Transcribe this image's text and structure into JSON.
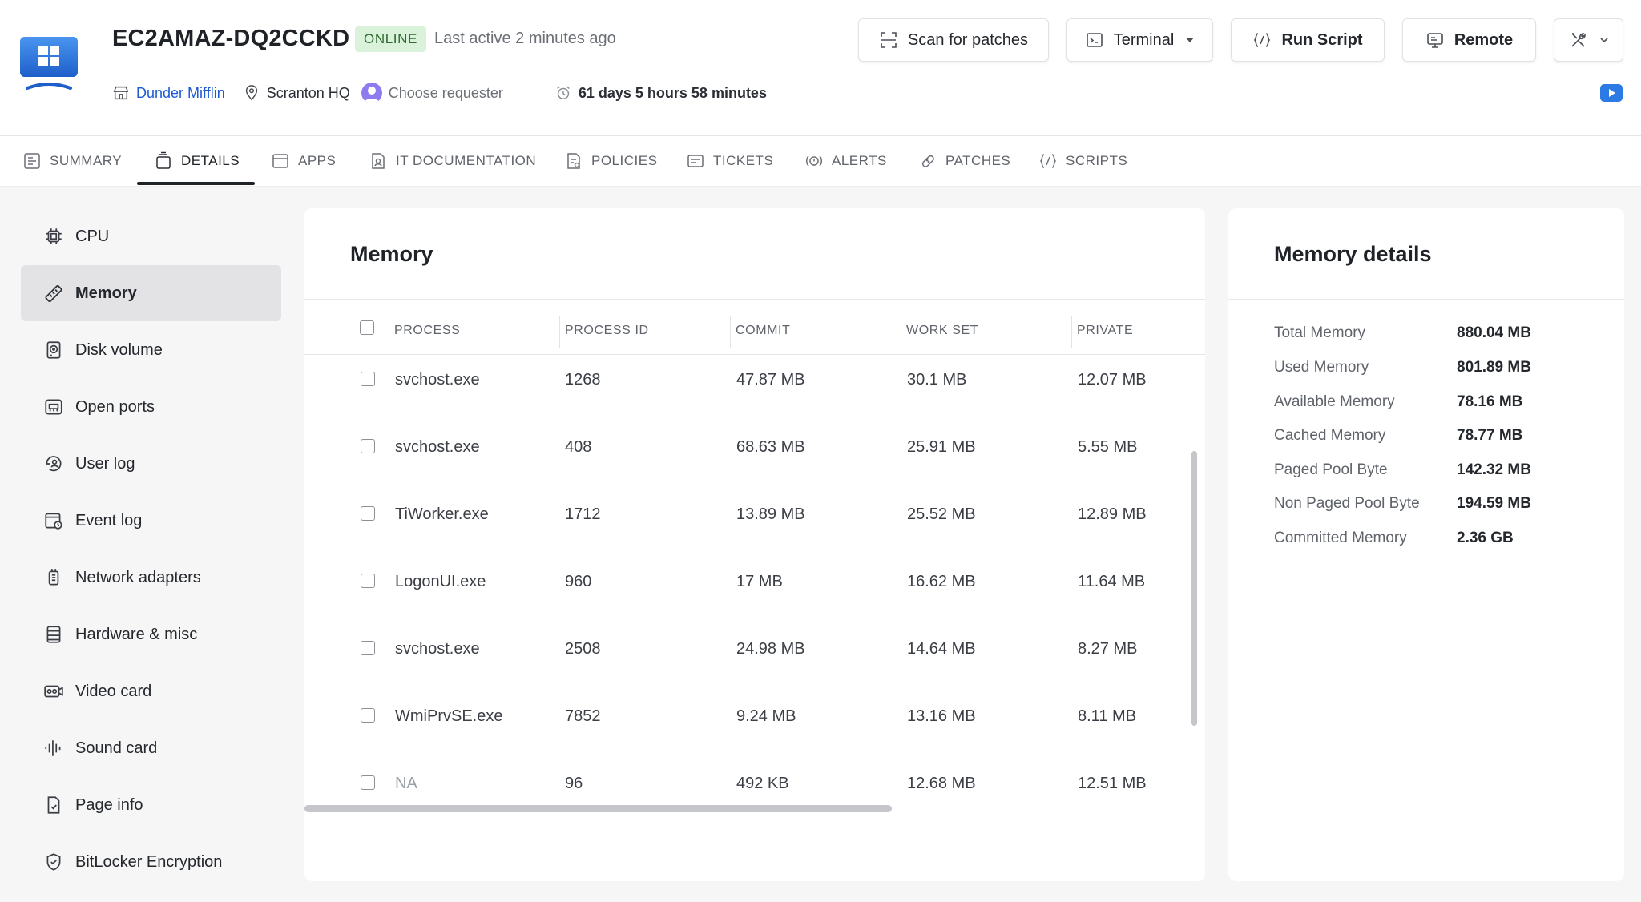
{
  "header": {
    "device_name": "EC2AMAZ-DQ2CCKD",
    "status": "ONLINE",
    "last_active": "Last active 2 minutes ago",
    "organization": "Dunder Mifflin",
    "location": "Scranton HQ",
    "requester_placeholder": "Choose requester",
    "uptime": "61 days 5 hours 58 minutes",
    "buttons": {
      "scan": "Scan for patches",
      "terminal": "Terminal",
      "run_script": "Run Script",
      "remote": "Remote"
    },
    "colors": {
      "status_bg": "#d9f2d9",
      "status_text": "#2f6b33",
      "link": "#1f5ad6",
      "windows_blue": "#2c7be5"
    }
  },
  "tabs": [
    {
      "label": "SUMMARY",
      "icon": "summary-icon"
    },
    {
      "label": "DETAILS",
      "icon": "details-icon",
      "active": true
    },
    {
      "label": "APPS",
      "icon": "apps-icon"
    },
    {
      "label": "IT DOCUMENTATION",
      "icon": "document-icon"
    },
    {
      "label": "POLICIES",
      "icon": "policies-icon"
    },
    {
      "label": "TICKETS",
      "icon": "ticket-icon"
    },
    {
      "label": "ALERTS",
      "icon": "alert-icon"
    },
    {
      "label": "PATCHES",
      "icon": "patch-icon"
    },
    {
      "label": "SCRIPTS",
      "icon": "script-icon"
    }
  ],
  "sidebar": {
    "items": [
      {
        "label": "CPU",
        "icon": "cpu-icon"
      },
      {
        "label": "Memory",
        "icon": "memory-icon",
        "active": true
      },
      {
        "label": "Disk volume",
        "icon": "disk-icon"
      },
      {
        "label": "Open ports",
        "icon": "ports-icon"
      },
      {
        "label": "User log",
        "icon": "user-log-icon"
      },
      {
        "label": "Event log",
        "icon": "event-log-icon"
      },
      {
        "label": "Network adapters",
        "icon": "network-adapter-icon"
      },
      {
        "label": "Hardware & misc",
        "icon": "hardware-icon"
      },
      {
        "label": "Video card",
        "icon": "video-card-icon"
      },
      {
        "label": "Sound card",
        "icon": "sound-card-icon"
      },
      {
        "label": "Page info",
        "icon": "page-info-icon"
      },
      {
        "label": "BitLocker Encryption",
        "icon": "shield-icon"
      }
    ]
  },
  "memory": {
    "title": "Memory",
    "columns": [
      "PROCESS",
      "PROCESS ID",
      "COMMIT",
      "WORK SET",
      "PRIVATE"
    ],
    "rows": [
      [
        "svchost.exe",
        "1268",
        "47.87 MB",
        "30.1 MB",
        "12.07 MB"
      ],
      [
        "svchost.exe",
        "408",
        "68.63 MB",
        "25.91 MB",
        "5.55 MB"
      ],
      [
        "TiWorker.exe",
        "1712",
        "13.89 MB",
        "25.52 MB",
        "12.89 MB"
      ],
      [
        "LogonUI.exe",
        "960",
        "17 MB",
        "16.62 MB",
        "11.64 MB"
      ],
      [
        "svchost.exe",
        "2508",
        "24.98 MB",
        "14.64 MB",
        "8.27 MB"
      ],
      [
        "WmiPrvSE.exe",
        "7852",
        "9.24 MB",
        "13.16 MB",
        "8.11 MB"
      ],
      [
        "NA",
        "96",
        "492 KB",
        "12.68 MB",
        "12.51 MB"
      ]
    ]
  },
  "memory_details": {
    "title": "Memory details",
    "items": [
      {
        "label": "Total Memory",
        "value": "880.04 MB"
      },
      {
        "label": "Used Memory",
        "value": "801.89 MB"
      },
      {
        "label": "Available Memory",
        "value": "78.16 MB"
      },
      {
        "label": "Cached Memory",
        "value": "78.77 MB"
      },
      {
        "label": "Paged Pool Byte",
        "value": "142.32 MB"
      },
      {
        "label": "Non Paged Pool Byte",
        "value": "194.59 MB"
      },
      {
        "label": "Committed Memory",
        "value": "2.36 GB"
      }
    ]
  }
}
